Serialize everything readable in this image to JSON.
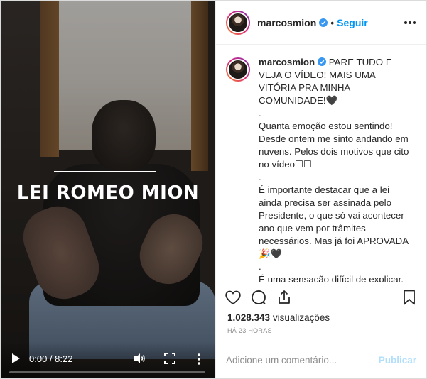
{
  "video": {
    "overlay_title": "LEI ROMEO MION",
    "time": "0:00 / 8:22",
    "progress": 0.0
  },
  "header": {
    "username": "marcosmion",
    "separator": "•",
    "follow_label": "Seguir"
  },
  "caption": {
    "username": "marcosmion",
    "text": " PARE TUDO E VEJA O VÍDEO! MAIS UMA VITÓRIA PRA MINHA COMUNIDADE!🖤\n.\nQuanta emoção estou sentindo! Desde ontem me sinto andando em nuvens. Pelos dois motivos que cito no vídeo☐☐\n.\nÉ importante destacar que a lei ainda precisa ser assinada pelo Presidente, o que só vai acontecer ano que vem por trâmites necessários. Mas já foi APROVADA🎉🖤\n.\nÉ uma sensação difícil de explicar, me dediquei incansavelmente atuando nos bastidores para a aprovação da lei, somando ao trabalho destemido"
  },
  "stats": {
    "views_count": "1.028.343",
    "views_label": "visualizações",
    "time_ago": "HÁ 23 HORAS"
  },
  "comment": {
    "placeholder": "Adicione um comentário...",
    "publish_label": "Publicar"
  },
  "colors": {
    "accent": "#0095f6",
    "publish_disabled": "#b2dffc",
    "muted": "#8e8e8e"
  }
}
